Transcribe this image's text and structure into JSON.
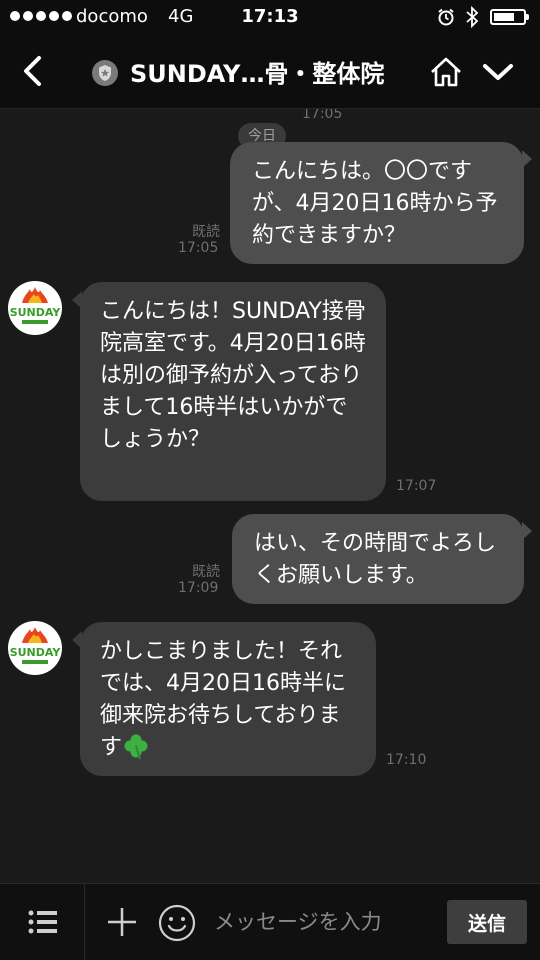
{
  "status_bar": {
    "carrier": "docomo",
    "network": "4G",
    "time": "17:13"
  },
  "header": {
    "title": "SUNDAY…骨・整体院",
    "icons": [
      "back-icon",
      "official-badge-icon",
      "home-icon",
      "chevron-down-icon"
    ]
  },
  "chat": {
    "top_partial_time": "17:05",
    "date_label": "今日",
    "avatar_text": "SUNDAY",
    "messages": [
      {
        "direction": "out",
        "text": "こんにちは。〇〇ですが、4月20日16時から予約できますか？",
        "read": "既読",
        "time": "17:05"
      },
      {
        "direction": "in",
        "text": "こんにちは！SUNDAY接骨院高室です。4月20日16時は別の御予約が入っておりまして16時半はいかがでしょうか？",
        "time": "17:07"
      },
      {
        "direction": "out",
        "text": "はい、その時間でよろしくお願いします。",
        "read": "既読",
        "time": "17:09"
      },
      {
        "direction": "in",
        "text": "かしこまりました！それでは、4月20日16時半に御来院お待ちしております",
        "emoji": "clover-icon",
        "time": "17:10"
      }
    ]
  },
  "input_bar": {
    "placeholder": "メッセージを入力",
    "send_label": "送信"
  },
  "colors": {
    "background": "#1a1a1a",
    "bar": "#0d0d0d",
    "bubble_out": "#4e4e4e",
    "bubble_in": "#3c3c3c",
    "timestamp": "#6f6f6f",
    "clover": "#3cb043"
  }
}
